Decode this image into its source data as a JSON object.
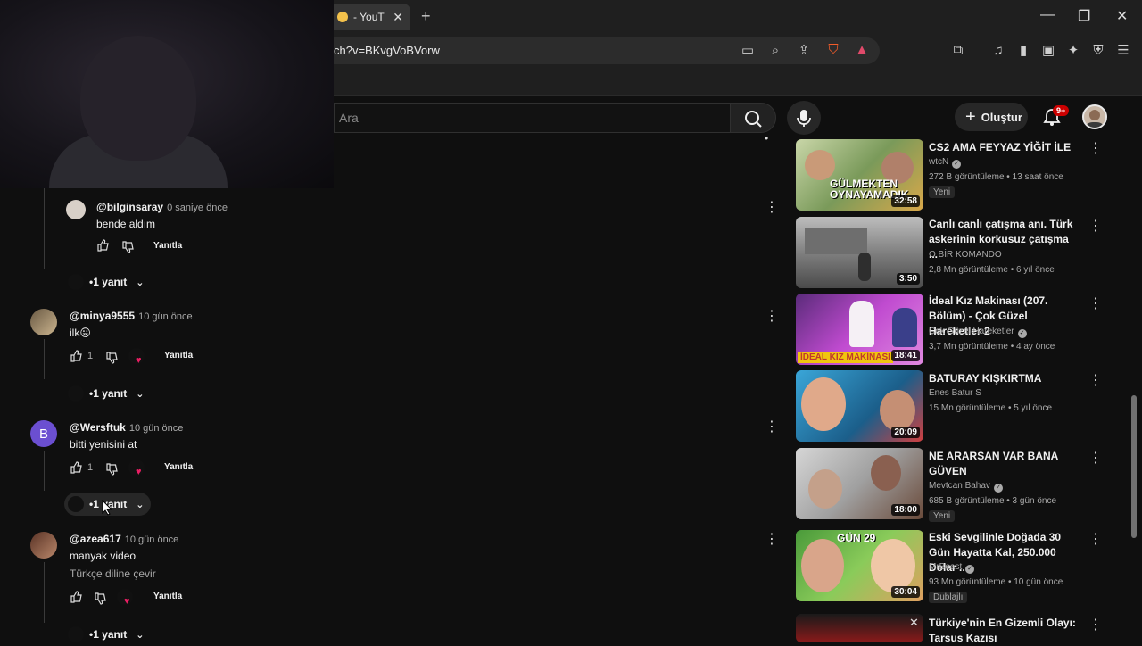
{
  "browser": {
    "tab_title": "- YouT",
    "url": "ch?v=BKvgVoBVorw"
  },
  "header": {
    "search_placeholder": "Ara",
    "create_label": "Oluştur",
    "notif_badge": "9+"
  },
  "comments": [
    {
      "user": "@bilginsaray",
      "time": "0 saniye önce",
      "text": "bende aldım",
      "likes": "",
      "reply_label": "Yanıtla",
      "replies": "1 yanıt",
      "creator_heart": false
    },
    {
      "user": "@minya9555",
      "time": "10 gün önce",
      "text": "ilk😛",
      "likes": "1",
      "reply_label": "Yanıtla",
      "replies": "1 yanıt",
      "creator_heart": true
    },
    {
      "user": "@Wersftuk",
      "time": "10 gün önce",
      "text": "bitti yenisini at",
      "likes": "1",
      "reply_label": "Yanıtla",
      "replies": "1 yanıt",
      "creator_heart": true,
      "avatar_letter": "B"
    },
    {
      "user": "@azea617",
      "time": "10 gün önce",
      "text": "manyak video",
      "translate": "Türkçe diline çevir",
      "likes": "",
      "reply_label": "Yanıtla",
      "replies": "1 yanıt",
      "creator_heart": true
    }
  ],
  "videos": [
    {
      "title": "CS2 AMA FEYYAZ YİĞİT İLE",
      "channel": "wtcN",
      "verified": true,
      "meta": "272 B görüntüleme • 13 saat önce",
      "badge": "Yeni",
      "duration": "32:58",
      "thumb_text": "GÜLMEKTEN OYNAYAMADIK"
    },
    {
      "title": "Canlı canlı çatışma anı. Türk askerinin korkusuz çatışma ...",
      "channel": "O BİR KOMANDO",
      "verified": false,
      "meta": "2,8 Mn görüntüleme • 6 yıl önce",
      "badge": "",
      "duration": "3:50",
      "thumb_text": ""
    },
    {
      "title": "İdeal Kız Makinası (207. Bölüm) - Çok Güzel Hareketler 2",
      "channel": "Çok Güzel Hareketler",
      "verified": true,
      "meta": "3,7 Mn görüntüleme • 4 ay önce",
      "badge": "",
      "duration": "18:41",
      "thumb_text": "İDEAL KIZ MAKİNASI"
    },
    {
      "title": "BATURAY KIŞKIRTMA",
      "channel": "Enes Batur S",
      "verified": false,
      "meta": "15 Mn görüntüleme • 5 yıl önce",
      "badge": "",
      "duration": "20:09",
      "thumb_text": ""
    },
    {
      "title": "NE ARARSAN VAR BANA GÜVEN",
      "channel": "Mevtcan Bahav",
      "verified": true,
      "meta": "685 B görüntüleme • 3 gün önce",
      "badge": "Yeni",
      "duration": "18:00",
      "thumb_text": ""
    },
    {
      "title": "Eski Sevgilinle Doğada 30 Gün Hayatta Kal, 250.000 Dolar ...",
      "channel": "MrBeast",
      "verified": true,
      "meta": "93 Mn görüntüleme • 10 gün önce",
      "badge": "Dublajlı",
      "duration": "30:04",
      "thumb_text": "GÜN 29"
    },
    {
      "title": "Türkiye'nin En Gizemli Olayı: Tarsus Kazısı",
      "channel": "",
      "verified": false,
      "meta": "",
      "badge": "",
      "duration": "",
      "thumb_text": ""
    }
  ],
  "colors": {
    "accent_red": "#cc0000",
    "heart": "#e91e63",
    "avatar_purple": "#6b4fd1"
  }
}
